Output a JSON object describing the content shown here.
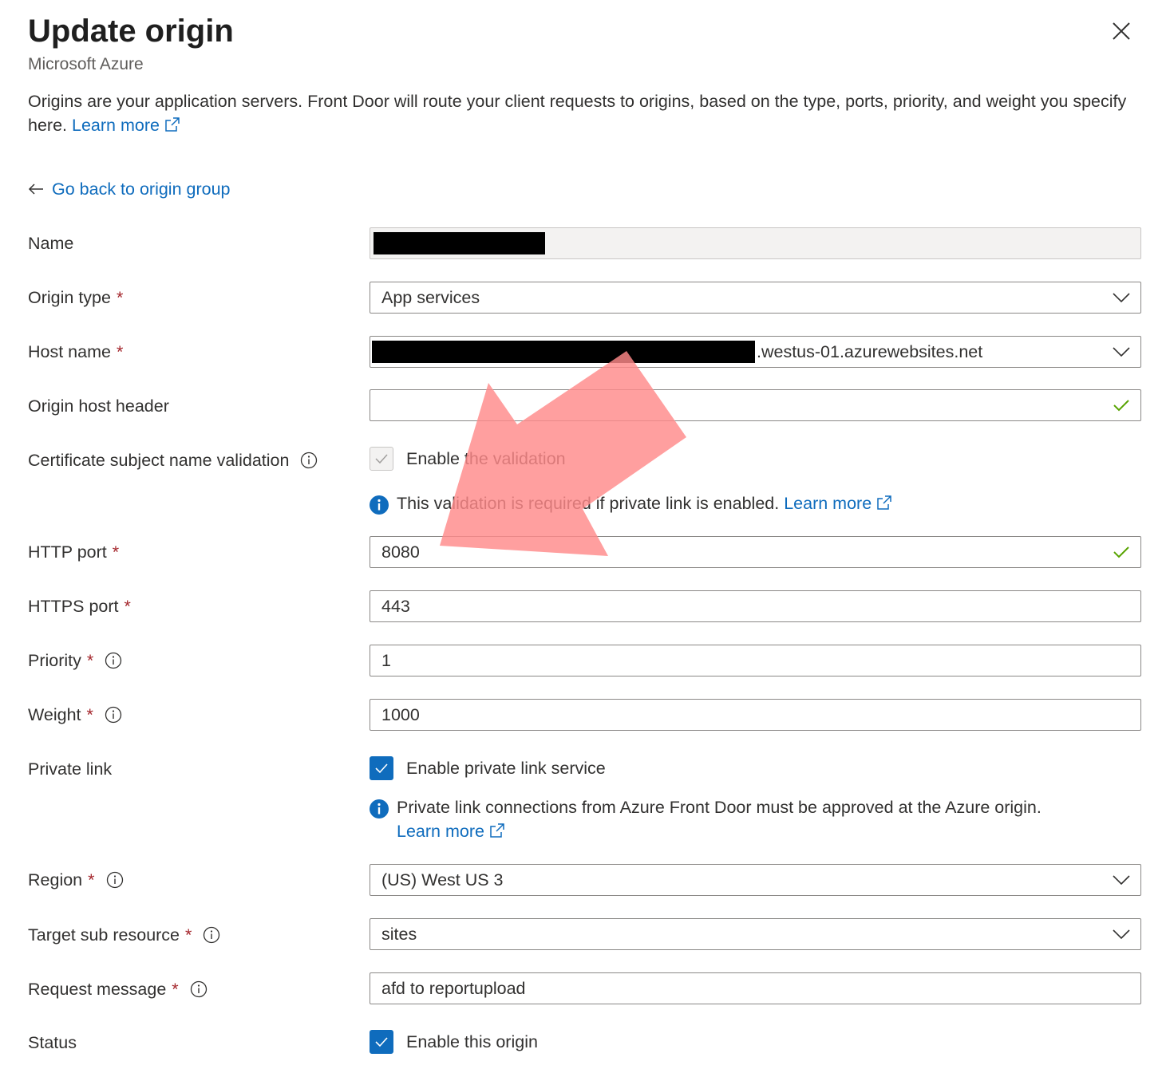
{
  "header": {
    "title": "Update origin",
    "subtitle": "Microsoft Azure",
    "description": "Origins are your application servers. Front Door will route your client requests to origins, based on the type, ports, priority, and weight you specify here.",
    "learn_more": "Learn more"
  },
  "back_link": "Go back to origin group",
  "form": {
    "name": {
      "label": "Name",
      "value": ""
    },
    "origin_type": {
      "label": "Origin type",
      "value": "App services"
    },
    "host_name": {
      "label": "Host name",
      "value_suffix": ".westus-01.azurewebsites.net"
    },
    "origin_host_header": {
      "label": "Origin host header",
      "value": ""
    },
    "cert_validation": {
      "label": "Certificate subject name validation",
      "checkbox_label": "Enable the validation",
      "checked": true,
      "disabled": true,
      "note": "This validation is required if private link is enabled.",
      "note_link": "Learn more"
    },
    "http_port": {
      "label": "HTTP port",
      "value": "8080"
    },
    "https_port": {
      "label": "HTTPS port",
      "value": "443"
    },
    "priority": {
      "label": "Priority",
      "value": "1"
    },
    "weight": {
      "label": "Weight",
      "value": "1000"
    },
    "private_link": {
      "label": "Private link",
      "checkbox_label": "Enable private link service",
      "checked": true,
      "note": "Private link connections from Azure Front Door must be approved at the Azure origin.",
      "note_link": "Learn more"
    },
    "region": {
      "label": "Region",
      "value": "(US) West US 3"
    },
    "target_sub_resource": {
      "label": "Target sub resource",
      "value": "sites"
    },
    "request_message": {
      "label": "Request message",
      "value": "afd to reportupload"
    },
    "status": {
      "label": "Status",
      "checkbox_label": "Enable this origin",
      "checked": true
    }
  },
  "required_mark": "*",
  "colors": {
    "link": "#0f6cbd",
    "required": "#a4262c",
    "checkbox_checked": "#0f6cbd",
    "valid_check": "#57a300",
    "annotation_arrow": "#ff8a8a"
  },
  "icons": {
    "close": "close-icon",
    "back": "arrow-left-icon",
    "external": "external-link-icon",
    "info": "info-circle-icon",
    "info_filled": "info-filled-icon",
    "chevron": "chevron-down-icon",
    "valid": "checkmark-icon"
  }
}
